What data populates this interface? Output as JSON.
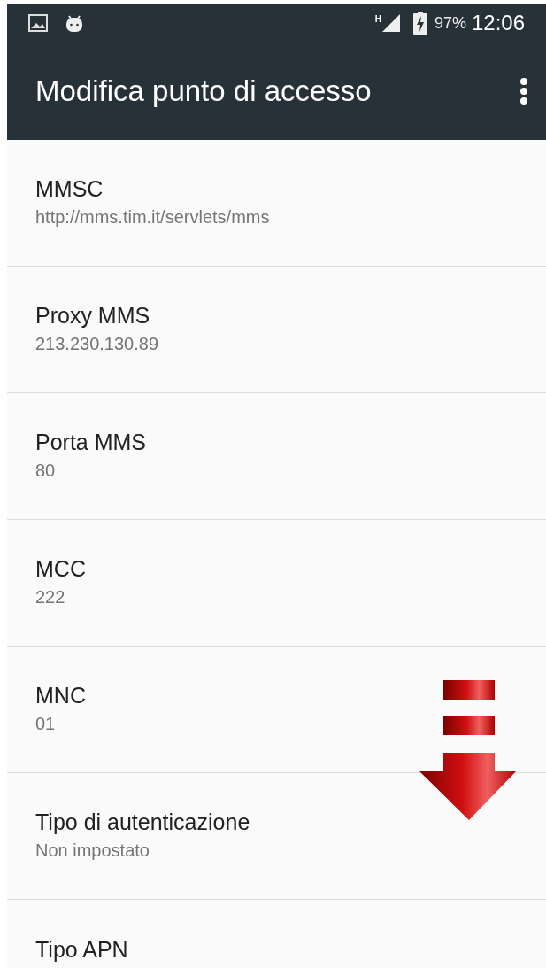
{
  "status_bar": {
    "network": "H",
    "battery": "97%",
    "time": "12:06"
  },
  "toolbar": {
    "title": "Modifica punto di accesso"
  },
  "settings": [
    {
      "title": "MMSC",
      "value": "http://mms.tim.it/servlets/mms"
    },
    {
      "title": "Proxy MMS",
      "value": "213.230.130.89"
    },
    {
      "title": "Porta MMS",
      "value": "80"
    },
    {
      "title": "MCC",
      "value": "222"
    },
    {
      "title": "MNC",
      "value": "01"
    },
    {
      "title": "Tipo di autenticazione",
      "value": "Non impostato"
    },
    {
      "title": "Tipo APN"
    }
  ]
}
